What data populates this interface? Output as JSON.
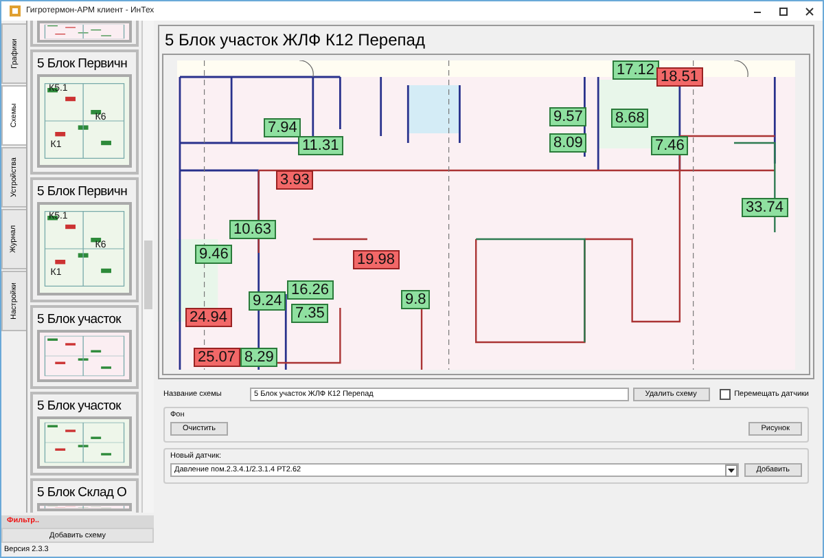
{
  "window": {
    "title": "Гигротермон-АРМ клиент - ИнТех"
  },
  "side_tabs": [
    {
      "label": "Графики",
      "selected": false
    },
    {
      "label": "Схемы",
      "selected": true
    },
    {
      "label": "Устройства",
      "selected": false
    },
    {
      "label": "Журнал",
      "selected": false
    },
    {
      "label": "Настройки",
      "selected": false
    }
  ],
  "schemes": [
    {
      "kind": "partial"
    },
    {
      "title": "5 Блок Первичн",
      "labels": [
        "К5.1",
        "К6",
        "К1"
      ]
    },
    {
      "title": "5 Блок Первичн",
      "labels": [
        "К5.1",
        "К6",
        "К1"
      ]
    },
    {
      "title": "5 Блок участок"
    },
    {
      "title": "5 Блок участок"
    },
    {
      "title": "5 Блок Склад О"
    }
  ],
  "filter": "Фильтр..",
  "add_scheme_button": "Добавить схему",
  "version": "Версия 2.3.3",
  "scheme": {
    "title": "5 Блок участок ЖЛФ К12 Перепад",
    "sensors": [
      {
        "value": "17.12",
        "alarm": false
      },
      {
        "value": "18.51",
        "alarm": true
      },
      {
        "value": "7.94",
        "alarm": false
      },
      {
        "value": "11.31",
        "alarm": false
      },
      {
        "value": "9.57",
        "alarm": false
      },
      {
        "value": "8.68",
        "alarm": false
      },
      {
        "value": "8.09",
        "alarm": false
      },
      {
        "value": "7.46",
        "alarm": false
      },
      {
        "value": "3.93",
        "alarm": true
      },
      {
        "value": "33.74",
        "alarm": false
      },
      {
        "value": "10.63",
        "alarm": false
      },
      {
        "value": "9.46",
        "alarm": false
      },
      {
        "value": "19.98",
        "alarm": true
      },
      {
        "value": "16.26",
        "alarm": false
      },
      {
        "value": "9.24",
        "alarm": false
      },
      {
        "value": "7.35",
        "alarm": false
      },
      {
        "value": "9.8",
        "alarm": false
      },
      {
        "value": "24.94",
        "alarm": true
      },
      {
        "value": "25.07",
        "alarm": true
      },
      {
        "value": "8.29",
        "alarm": false
      }
    ]
  },
  "form": {
    "name_label": "Название схемы",
    "name_value": "5 Блок участок ЖЛФ К12 Перепад",
    "delete_button": "Удалить схему",
    "move_sensors": {
      "label": "Перемещать датчики",
      "checked": false
    },
    "background_group": "Фон",
    "clear_button": "Очистить",
    "picture_button": "Рисунок",
    "new_sensor_group": "Новый датчик:",
    "new_sensor_value": "Давление пом.2.3.4.1/2.3.1.4 РТ2.62",
    "add_button": "Добавить"
  }
}
